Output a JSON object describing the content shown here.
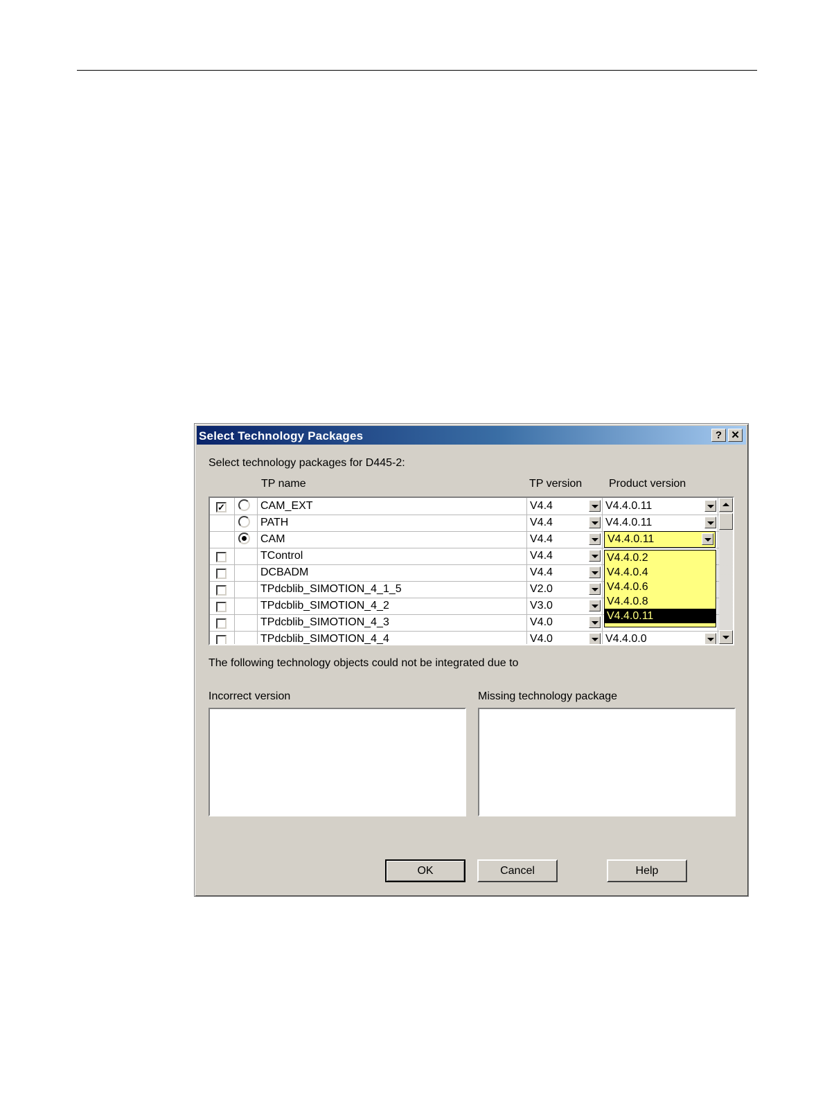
{
  "dialog": {
    "title": "Select Technology Packages",
    "help_glyph": "?",
    "close_glyph": "✕",
    "prompt": "Select technology packages for D445-2:",
    "columns": {
      "name": "TP name",
      "tp_version": "TP version",
      "product_version": "Product version"
    },
    "rows": [
      {
        "name": "CAM_EXT",
        "tp_version": "V4.4",
        "product_version": "V4.4.0.11",
        "checkbox": "checked",
        "radio": "off"
      },
      {
        "name": "PATH",
        "tp_version": "V4.4",
        "product_version": "V4.4.0.11",
        "checkbox": "none",
        "radio": "off"
      },
      {
        "name": "CAM",
        "tp_version": "V4.4",
        "product_version": "V4.4.0.11",
        "checkbox": "none",
        "radio": "on"
      },
      {
        "name": "TControl",
        "tp_version": "V4.4",
        "product_version": "",
        "checkbox": "unchecked",
        "radio": "none"
      },
      {
        "name": "DCBADM",
        "tp_version": "V4.4",
        "product_version": "",
        "checkbox": "unchecked",
        "radio": "none"
      },
      {
        "name": "TPdcblib_SIMOTION_4_1_5",
        "tp_version": "V2.0",
        "product_version": "",
        "checkbox": "unchecked",
        "radio": "none"
      },
      {
        "name": "TPdcblib_SIMOTION_4_2",
        "tp_version": "V3.0",
        "product_version": "",
        "checkbox": "unchecked",
        "radio": "none"
      },
      {
        "name": "TPdcblib_SIMOTION_4_3",
        "tp_version": "V4.0",
        "product_version": "",
        "checkbox": "unchecked",
        "radio": "none"
      },
      {
        "name": "TPdcblib_SIMOTION_4_4",
        "tp_version": "V4.0",
        "product_version": "V4.4.0.0",
        "checkbox": "unchecked",
        "radio": "none"
      }
    ],
    "product_dropdown": {
      "selected": "V4.4.0.11",
      "options": [
        "V4.4.0.2",
        "V4.4.0.4",
        "V4.4.0.6",
        "V4.4.0.8",
        "V4.4.0.11"
      ],
      "highlight_color": "#ffff80"
    },
    "integration_note": "The following technology objects could not be integrated due to",
    "incorrect_version_label": "Incorrect version",
    "missing_package_label": "Missing technology package",
    "buttons": {
      "ok": "OK",
      "cancel": "Cancel",
      "help": "Help"
    }
  }
}
